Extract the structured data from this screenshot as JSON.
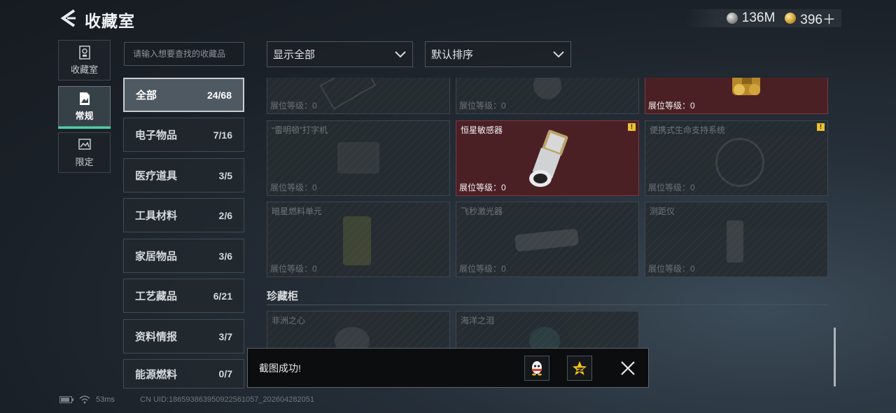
{
  "header": {
    "title": "收藏室",
    "currencies": [
      {
        "icon": "silver-coin-icon",
        "value": "136M"
      },
      {
        "icon": "gold-coin-icon",
        "value": "396＋"
      }
    ]
  },
  "side_tabs": [
    {
      "label": "收藏室",
      "icon": "collection-room-icon",
      "active": false
    },
    {
      "label": "常规",
      "icon": "regular-icon",
      "active": true
    },
    {
      "label": "限定",
      "icon": "limited-icon",
      "active": false
    }
  ],
  "search": {
    "placeholder": "请输入想要查找的收藏品"
  },
  "categories": [
    {
      "name": "全部",
      "count": "24/68",
      "active": true
    },
    {
      "name": "电子物品",
      "count": "7/16"
    },
    {
      "name": "医疗道具",
      "count": "3/5"
    },
    {
      "name": "工具材料",
      "count": "2/6"
    },
    {
      "name": "家居物品",
      "count": "3/6"
    },
    {
      "name": "工艺藏品",
      "count": "6/21"
    },
    {
      "name": "资料情报",
      "count": "3/7"
    },
    {
      "name": "能源燃料",
      "count": "0/7"
    }
  ],
  "filters": {
    "show": "显示全部",
    "sort": "默认排序"
  },
  "items_row1": [
    {
      "name": "",
      "level": "展位等级：0",
      "owned": false
    },
    {
      "name": "",
      "level": "展位等级：0",
      "owned": false
    },
    {
      "name": "",
      "level": "展位等级：0",
      "owned": true
    }
  ],
  "items_row2": [
    {
      "name": "“雷明顿”打字机",
      "level": "展位等级：0",
      "owned": false,
      "warn": false
    },
    {
      "name": "恒星敏感器",
      "level": "展位等级：0",
      "owned": true,
      "warn": true
    },
    {
      "name": "便携式生命支持系统",
      "level": "展位等级：0",
      "owned": false,
      "warn": true
    }
  ],
  "items_row3": [
    {
      "name": "暗星燃料单元",
      "level": "展位等级：0",
      "owned": false
    },
    {
      "name": "飞秒激光器",
      "level": "展位等级：0",
      "owned": false
    },
    {
      "name": "测距仪",
      "level": "展位等级：0",
      "owned": false
    }
  ],
  "section": {
    "title": "珍藏柜"
  },
  "items_row4": [
    {
      "name": "非洲之心",
      "owned": false
    },
    {
      "name": "海洋之泪",
      "owned": false
    }
  ],
  "toast": {
    "text": "截图成功!"
  },
  "status": {
    "ping": "53ms",
    "uid": "CN UID:18659386395092256105​7_202604282051"
  }
}
